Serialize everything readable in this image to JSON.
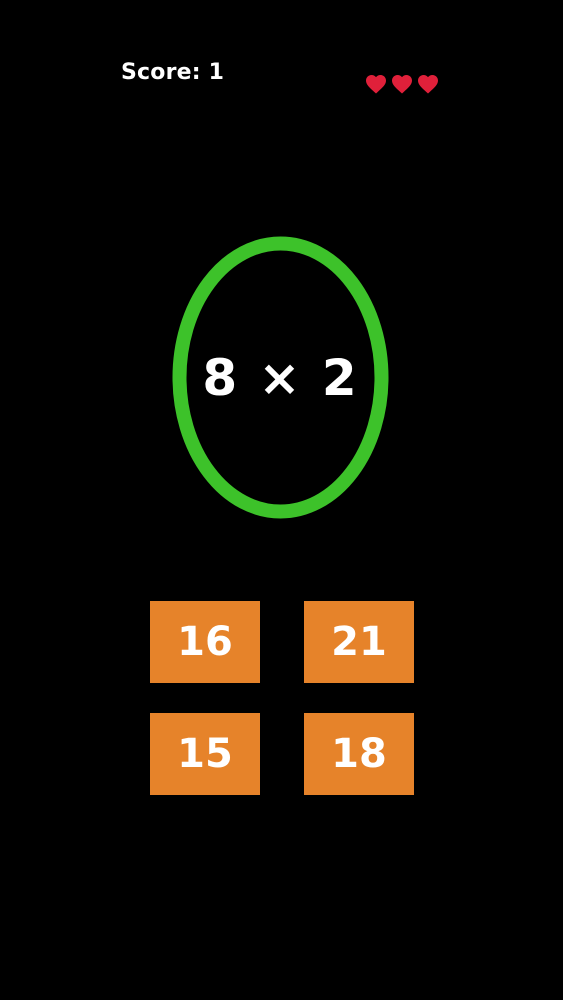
{
  "hud": {
    "score_text": "Score: 1",
    "lives": 3,
    "heart_icon": "heart-icon",
    "heart_color": "#e0203a"
  },
  "question": {
    "text": "8 × 2",
    "ring_color": "#3dc22a"
  },
  "answers": [
    {
      "label": "16"
    },
    {
      "label": "21"
    },
    {
      "label": "15"
    },
    {
      "label": "18"
    }
  ],
  "colors": {
    "background": "#000000",
    "answer_tile": "#e6832a",
    "text": "#ffffff"
  }
}
